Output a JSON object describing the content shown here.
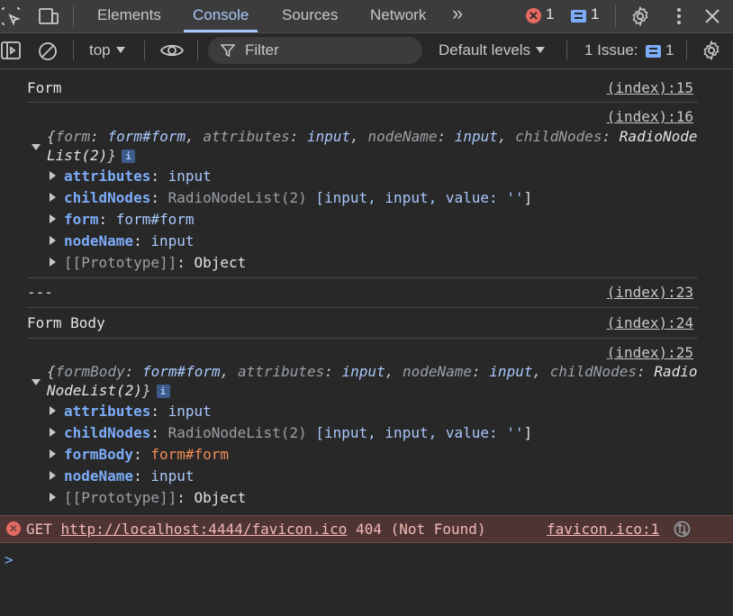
{
  "tabs": [
    {
      "label": "Elements",
      "active": false
    },
    {
      "label": "Console",
      "active": true
    },
    {
      "label": "Sources",
      "active": false
    },
    {
      "label": "Network",
      "active": false
    }
  ],
  "more_tabs_label": "»",
  "error_count": "1",
  "message_count": "1",
  "toolbar": {
    "context": "top",
    "filter_placeholder": "Filter",
    "levels": "Default levels",
    "issues_label": "1 Issue:",
    "issues_count": "1"
  },
  "log": {
    "form_label": {
      "text": "Form",
      "source": "(index):15"
    },
    "form_obj": {
      "source": "(index):16",
      "summary": [
        {
          "k": "form",
          "v": "form#form"
        },
        {
          "k": "attributes",
          "v": "input"
        },
        {
          "k": "nodeName",
          "v": "input"
        },
        {
          "k": "childNodes",
          "v": "RadioNodeList(2)"
        }
      ],
      "props": {
        "attributes": {
          "key": "attributes",
          "val": "input"
        },
        "childNodes": {
          "key": "childNodes",
          "type": "RadioNodeList(2)",
          "items": "[input, input, value: ''",
          "close": "]"
        },
        "main": {
          "key": "form",
          "val": "form#form"
        },
        "nodeName": {
          "key": "nodeName",
          "val": "input"
        },
        "proto": {
          "key": "[[Prototype]]",
          "val": "Object"
        }
      }
    },
    "separator": {
      "text": "---",
      "source": "(index):23"
    },
    "body_label": {
      "text": "Form Body",
      "source": "(index):24"
    },
    "body_obj": {
      "source": "(index):25",
      "summary": [
        {
          "k": "formBody",
          "v": "form#form"
        },
        {
          "k": "attributes",
          "v": "input"
        },
        {
          "k": "nodeName",
          "v": "input"
        },
        {
          "k": "childNodes",
          "v": "RadioNodeList(2)"
        }
      ],
      "props": {
        "attributes": {
          "key": "attributes",
          "val": "input"
        },
        "childNodes": {
          "key": "childNodes",
          "type": "RadioNodeList(2)",
          "items": "[input, input, value: ''",
          "close": "]"
        },
        "main": {
          "key": "formBody",
          "val": "form#form"
        },
        "nodeName": {
          "key": "nodeName",
          "val": "input"
        },
        "proto": {
          "key": "[[Prototype]]",
          "val": "Object"
        }
      }
    },
    "error": {
      "method": "GET",
      "url": "http://localhost:4444/favicon.ico",
      "status": "404 (Not Found)",
      "source": "favicon.ico:1"
    },
    "prompt": ">"
  },
  "colors": {
    "accent": "#a8c7fa",
    "error": "#e46962",
    "error_bg": "#4e3534",
    "background": "#282828"
  }
}
